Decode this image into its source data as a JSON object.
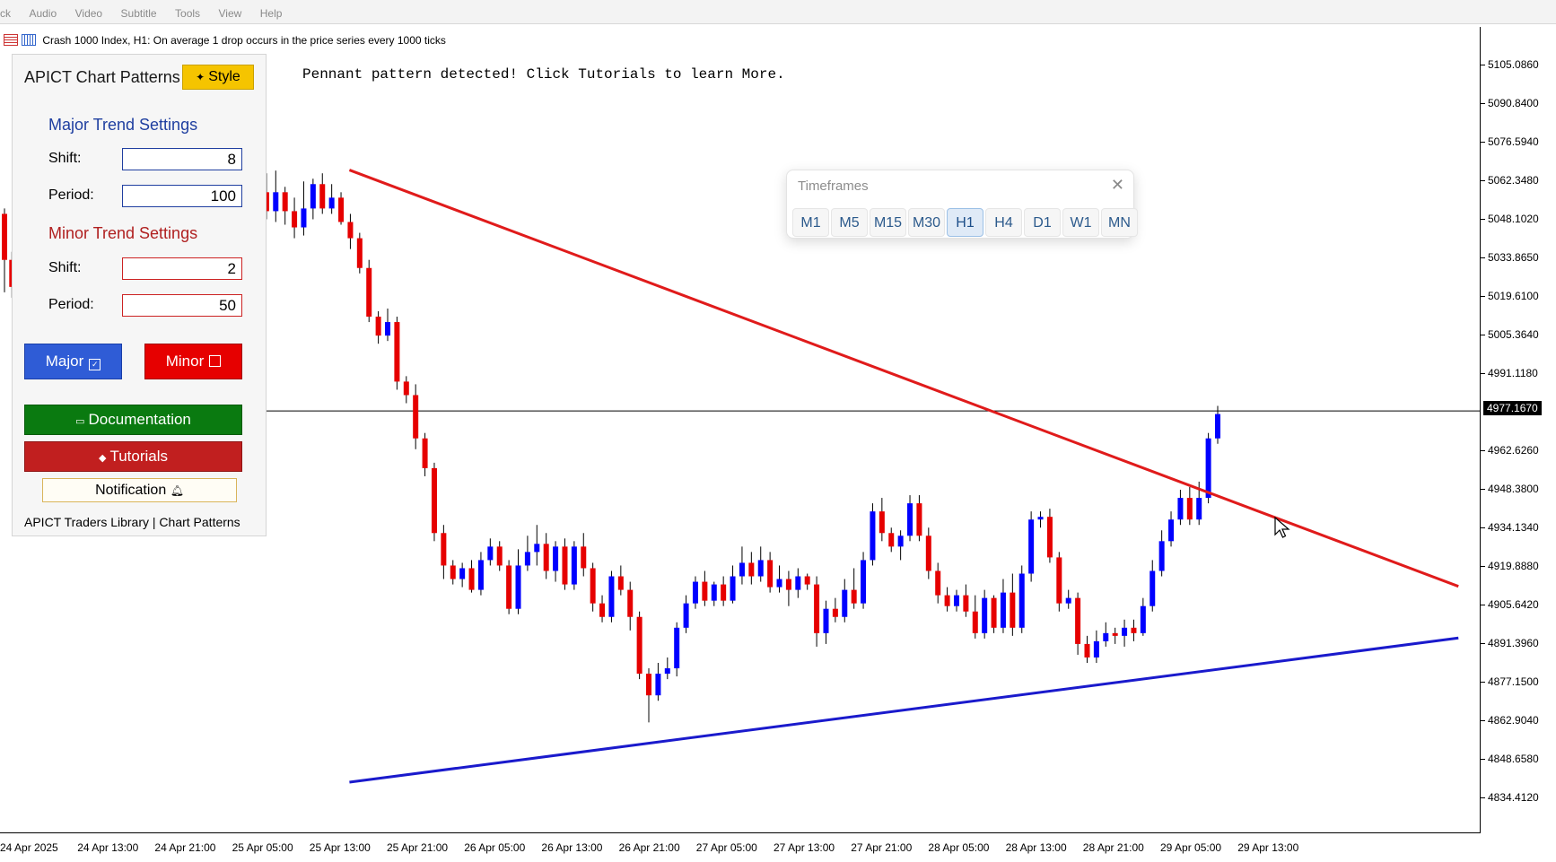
{
  "menubar": [
    "ck",
    "Audio",
    "Video",
    "Subtitle",
    "Tools",
    "View",
    "Help"
  ],
  "window_title": "Crash 1000 Index, H1:  On average 1 drop occurs in the price series every 1000 ticks",
  "message": "Pennant pattern detected! Click Tutorials to learn More.",
  "panel": {
    "title": "APICT Chart Patterns",
    "style_label": "Style",
    "major_heading": "Major Trend Settings",
    "minor_heading": "Minor Trend Settings",
    "shift_label": "Shift:",
    "period_label": "Period:",
    "major_shift": "8",
    "major_period": "100",
    "minor_shift": "2",
    "minor_period": "50",
    "major_button": "Major",
    "minor_button": "Minor",
    "documentation_button": "Documentation",
    "tutorials_button": "Tutorials",
    "notification_button": "Notification",
    "footer": "APICT Traders Library | Chart Patterns"
  },
  "timeframes": {
    "title": "Timeframes",
    "options": [
      "M1",
      "M5",
      "M15",
      "M30",
      "H1",
      "H4",
      "D1",
      "W1",
      "MN"
    ],
    "selected": "H1"
  },
  "colors": {
    "bull": "#0000ff",
    "bear": "#e60000",
    "major_line": "#e01b1b",
    "minor_line": "#1a1acc",
    "accent_style": "#f5c400"
  },
  "icons": [
    "chart-properties-icon",
    "symbol-icon",
    "close-icon",
    "mouse-pointer-icon"
  ],
  "chart_data": {
    "type": "candlestick",
    "symbol": "Crash 1000 Index",
    "timeframe": "H1",
    "ylim": [
      4827.3,
      5110.5
    ],
    "y_ticks": [
      "5105.0860",
      "5090.8400",
      "5076.5940",
      "5062.3480",
      "5048.1020",
      "5033.8650",
      "5019.6100",
      "5005.3640",
      "4991.1180",
      "4977.1670",
      "4962.6260",
      "4948.3800",
      "4934.1340",
      "4919.8880",
      "4905.6420",
      "4891.3960",
      "4877.1500",
      "4862.9040",
      "4848.6580",
      "4834.4120"
    ],
    "current_price": "4977.1670",
    "x_labels": [
      "24 Apr 2025",
      "24 Apr 13:00",
      "24 Apr 21:00",
      "25 Apr 05:00",
      "25 Apr 13:00",
      "25 Apr 21:00",
      "26 Apr 05:00",
      "26 Apr 13:00",
      "26 Apr 21:00",
      "27 Apr 05:00",
      "27 Apr 13:00",
      "27 Apr 21:00",
      "28 Apr 05:00",
      "28 Apr 13:00",
      "28 Apr 21:00",
      "29 Apr 05:00",
      "29 Apr 13:00"
    ],
    "candles": [
      [
        5050,
        5033,
        5052,
        5021
      ],
      [
        5033,
        5023,
        5036,
        5019
      ],
      [
        5071,
        5058,
        5076,
        5055
      ],
      [
        5058,
        5051,
        5065,
        5048
      ],
      [
        5051,
        5058,
        5066,
        5047
      ],
      [
        5058,
        5051,
        5060,
        5046
      ],
      [
        5051,
        5045,
        5056,
        5041
      ],
      [
        5045,
        5052,
        5062,
        5042
      ],
      [
        5052,
        5061,
        5063,
        5048
      ],
      [
        5061,
        5052,
        5065,
        5050
      ],
      [
        5052,
        5056,
        5061,
        5050
      ],
      [
        5056,
        5047,
        5058,
        5046
      ],
      [
        5047,
        5041,
        5050,
        5037
      ],
      [
        5041,
        5030,
        5043,
        5028
      ],
      [
        5030,
        5012,
        5033,
        5010
      ],
      [
        5012,
        5005,
        5014,
        5002
      ],
      [
        5005,
        5010,
        5015,
        5003
      ],
      [
        5010,
        4988,
        5012,
        4985
      ],
      [
        4988,
        4983,
        4990,
        4980
      ],
      [
        4983,
        4967,
        4987,
        4963
      ],
      [
        4967,
        4956,
        4969,
        4953
      ],
      [
        4956,
        4932,
        4958,
        4929
      ],
      [
        4932,
        4920,
        4935,
        4915
      ],
      [
        4920,
        4915,
        4922,
        4913
      ],
      [
        4915,
        4919,
        4921,
        4912
      ],
      [
        4919,
        4911,
        4922,
        4910
      ],
      [
        4911,
        4922,
        4925,
        4909
      ],
      [
        4922,
        4927,
        4930,
        4920
      ],
      [
        4927,
        4920,
        4929,
        4918
      ],
      [
        4920,
        4904,
        4922,
        4902
      ],
      [
        4904,
        4920,
        4926,
        4902
      ],
      [
        4920,
        4925,
        4931,
        4918
      ],
      [
        4925,
        4928,
        4935,
        4920
      ],
      [
        4928,
        4918,
        4932,
        4915
      ],
      [
        4918,
        4927,
        4929,
        4914
      ],
      [
        4927,
        4913,
        4930,
        4911
      ],
      [
        4913,
        4927,
        4929,
        4911
      ],
      [
        4927,
        4919,
        4932,
        4916
      ],
      [
        4919,
        4906,
        4921,
        4903
      ],
      [
        4906,
        4901,
        4909,
        4899
      ],
      [
        4901,
        4916,
        4918,
        4899
      ],
      [
        4916,
        4911,
        4920,
        4909
      ],
      [
        4911,
        4901,
        4914,
        4896
      ],
      [
        4901,
        4880,
        4903,
        4878
      ],
      [
        4880,
        4872,
        4882,
        4862
      ],
      [
        4872,
        4880,
        4884,
        4870
      ],
      [
        4880,
        4882,
        4886,
        4878
      ],
      [
        4882,
        4897,
        4899,
        4879
      ],
      [
        4897,
        4906,
        4909,
        4895
      ],
      [
        4906,
        4914,
        4916,
        4904
      ],
      [
        4914,
        4907,
        4918,
        4905
      ],
      [
        4907,
        4913,
        4914,
        4905
      ],
      [
        4913,
        4907,
        4916,
        4905
      ],
      [
        4907,
        4916,
        4920,
        4906
      ],
      [
        4916,
        4921,
        4927,
        4913
      ],
      [
        4921,
        4916,
        4925,
        4913
      ],
      [
        4916,
        4922,
        4927,
        4914
      ],
      [
        4922,
        4912,
        4925,
        4910
      ],
      [
        4912,
        4915,
        4920,
        4910
      ],
      [
        4915,
        4911,
        4918,
        4905
      ],
      [
        4911,
        4916,
        4919,
        4908
      ],
      [
        4916,
        4913,
        4917,
        4911
      ],
      [
        4913,
        4895,
        4916,
        4890
      ],
      [
        4895,
        4904,
        4907,
        4891
      ],
      [
        4904,
        4901,
        4908,
        4899
      ],
      [
        4901,
        4911,
        4915,
        4899
      ],
      [
        4911,
        4906,
        4919,
        4904
      ],
      [
        4906,
        4922,
        4925,
        4904
      ],
      [
        4922,
        4940,
        4943,
        4920
      ],
      [
        4940,
        4932,
        4945,
        4929
      ],
      [
        4932,
        4927,
        4934,
        4925
      ],
      [
        4927,
        4931,
        4933,
        4922
      ],
      [
        4931,
        4943,
        4946,
        4929
      ],
      [
        4943,
        4931,
        4946,
        4929
      ],
      [
        4931,
        4918,
        4934,
        4915
      ],
      [
        4918,
        4909,
        4921,
        4906
      ],
      [
        4909,
        4905,
        4912,
        4903
      ],
      [
        4905,
        4909,
        4911,
        4903
      ],
      [
        4909,
        4903,
        4913,
        4901
      ],
      [
        4903,
        4895,
        4909,
        4893
      ],
      [
        4895,
        4908,
        4911,
        4893
      ],
      [
        4908,
        4897,
        4909,
        4895
      ],
      [
        4897,
        4910,
        4915,
        4895
      ],
      [
        4910,
        4897,
        4917,
        4894
      ],
      [
        4897,
        4917,
        4920,
        4895
      ],
      [
        4917,
        4937,
        4940,
        4914
      ],
      [
        4937,
        4938,
        4940,
        4934
      ],
      [
        4938,
        4923,
        4941,
        4921
      ],
      [
        4923,
        4906,
        4925,
        4903
      ],
      [
        4906,
        4908,
        4911,
        4904
      ],
      [
        4908,
        4891,
        4910,
        4887
      ],
      [
        4891,
        4886,
        4894,
        4884
      ],
      [
        4886,
        4892,
        4896,
        4884
      ],
      [
        4892,
        4895,
        4899,
        4890
      ],
      [
        4895,
        4894,
        4897,
        4891
      ],
      [
        4894,
        4897,
        4900,
        4890
      ],
      [
        4897,
        4895,
        4900,
        4892
      ],
      [
        4895,
        4905,
        4908,
        4894
      ],
      [
        4905,
        4918,
        4922,
        4903
      ],
      [
        4918,
        4929,
        4933,
        4916
      ],
      [
        4929,
        4937,
        4940,
        4927
      ],
      [
        4937,
        4945,
        4948,
        4935
      ],
      [
        4945,
        4937,
        4949,
        4935
      ],
      [
        4937,
        4945,
        4951,
        4935
      ],
      [
        4945,
        4967,
        4969,
        4943
      ],
      [
        4967,
        4976,
        4979,
        4965
      ]
    ],
    "trendlines": [
      {
        "name": "Major",
        "color": "#e01b1b",
        "points": [
          [
            0.236,
            5066.2
          ],
          [
            0.985,
            4912.3
          ]
        ]
      },
      {
        "name": "Minor",
        "color": "#1a1acc",
        "points": [
          [
            0.236,
            4839.9
          ],
          [
            0.985,
            4893.2
          ]
        ]
      }
    ]
  }
}
